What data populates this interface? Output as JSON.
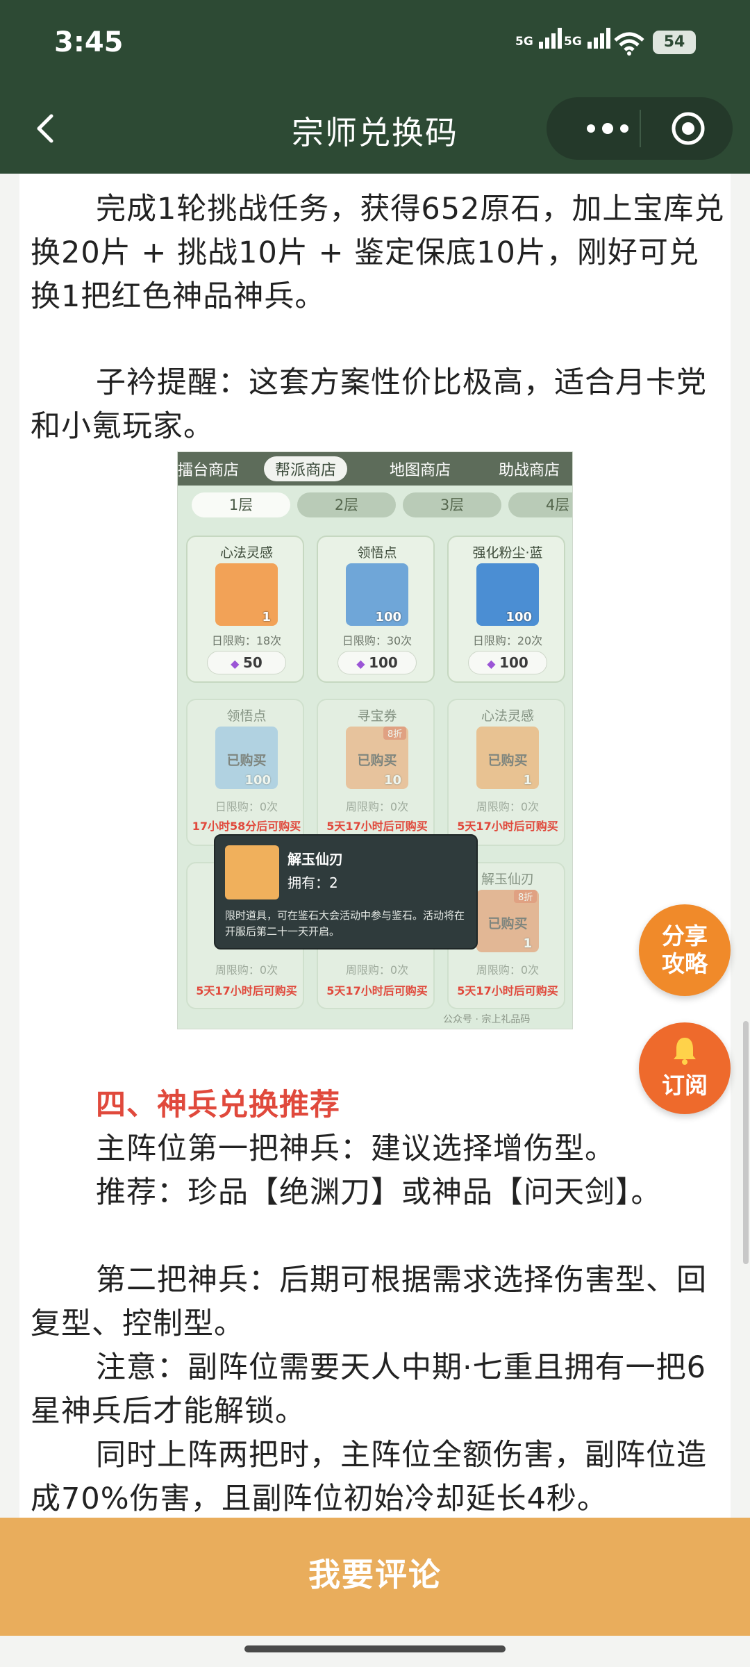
{
  "status_bar": {
    "time": "3:45",
    "signal1": "5G",
    "signal2": "5G",
    "battery": "54"
  },
  "header": {
    "title": "宗师兑换码"
  },
  "article": {
    "p1": "完成1轮挑战任务，获得652原石，加上宝库兑换20片 + 挑战10片 + 鉴定保底10片，刚好可兑换1把红色神品神兵。",
    "p2": "子衿提醒：这套方案性价比极高，适合月卡党和小氪玩家。",
    "section_heading": "四、神兵兑换推荐",
    "p3": "主阵位第一把神兵：建议选择增伤型。",
    "p4": "推荐：珍品【绝渊刀】或神品【问天剑】。",
    "p5": "第二把神兵：后期可根据需求选择伤害型、回复型、控制型。",
    "p6": "注意：副阵位需要天人中期·七重且拥有一把6星神兵后才能解锁。",
    "p7": "同时上阵两把时，主阵位全额伤害，副阵位造成70%伤害，且副阵位初始冷却延长4秒。"
  },
  "shop_image": {
    "tabs": [
      "擂台商店",
      "帮派商店",
      "地图商店",
      "助战商店"
    ],
    "floors": [
      "1层",
      "2层",
      "3层",
      "4层"
    ],
    "row1": [
      {
        "name": "心法灵感",
        "qty": "1",
        "limit": "日限购：18次",
        "price": "50"
      },
      {
        "name": "领悟点",
        "qty": "100",
        "limit": "日限购：30次",
        "price": "100"
      },
      {
        "name": "强化粉尘·蓝",
        "qty": "100",
        "limit": "日限购：20次",
        "price": "100"
      }
    ],
    "row2": [
      {
        "name": "领悟点",
        "qty": "100",
        "bought": "已购买",
        "limit": "日限购：0次",
        "restock": "17小时58分后可购买"
      },
      {
        "name": "寻宝券",
        "qty": "10",
        "bought": "已购买",
        "badge": "8折",
        "limit": "周限购：0次",
        "restock": "5天17小时后可购买"
      },
      {
        "name": "心法灵感",
        "qty": "1",
        "bought": "已购买",
        "limit": "周限购：0次",
        "restock": "5天17小时后可购买"
      }
    ],
    "row3": [
      {
        "limit": "周限购：0次",
        "restock": "5天17小时后可购买"
      },
      {
        "limit": "周限购：0次",
        "restock": "5天17小时后可购买"
      },
      {
        "name": "解玉仙刃",
        "qty": "1",
        "bought": "已购买",
        "badge": "8折",
        "limit": "周限购：0次",
        "restock": "5天17小时后可购买"
      }
    ],
    "tooltip": {
      "name": "解玉仙刃",
      "owned": "拥有：2",
      "desc": "限时道具，可在鉴石大会活动中参与鉴石。活动将在开服后第二十一天开启。"
    },
    "watermark": "公众号 · 宗上礼品码"
  },
  "fab": {
    "share_line1": "分享",
    "share_line2": "攻略",
    "subscribe": "订阅"
  },
  "bottom": {
    "comment": "我要评论"
  }
}
